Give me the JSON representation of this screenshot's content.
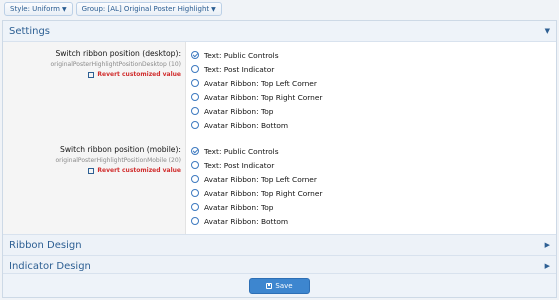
{
  "toolbar": {
    "style_button": "Style: Uniform",
    "group_button": "Group: [AL] Original Poster Highlight"
  },
  "settings": {
    "title": "Settings",
    "rows": [
      {
        "label": "Switch ribbon position (desktop):",
        "id": "originalPosterHighlightPositionDesktop (10)",
        "revert": "Revert customized value",
        "options": [
          "Text: Public Controls",
          "Text: Post Indicator",
          "Avatar Ribbon: Top Left Corner",
          "Avatar Ribbon: Top Right Corner",
          "Avatar Ribbon: Top",
          "Avatar Ribbon: Bottom"
        ],
        "selected": "Text: Public Controls"
      },
      {
        "label": "Switch ribbon position (mobile):",
        "id": "originalPosterHighlightPositionMobile (20)",
        "revert": "Revert customized value",
        "options": [
          "Text: Public Controls",
          "Text: Post Indicator",
          "Avatar Ribbon: Top Left Corner",
          "Avatar Ribbon: Top Right Corner",
          "Avatar Ribbon: Top",
          "Avatar Ribbon: Bottom"
        ],
        "selected": "Text: Public Controls"
      }
    ]
  },
  "sections": {
    "ribbon_design": "Ribbon Design",
    "indicator_design": "Indicator Design"
  },
  "footer": {
    "save_label": "Save"
  },
  "colors": {
    "accent": "#2d5f93",
    "revert": "#d12e2e",
    "save": "#3d86cf"
  }
}
